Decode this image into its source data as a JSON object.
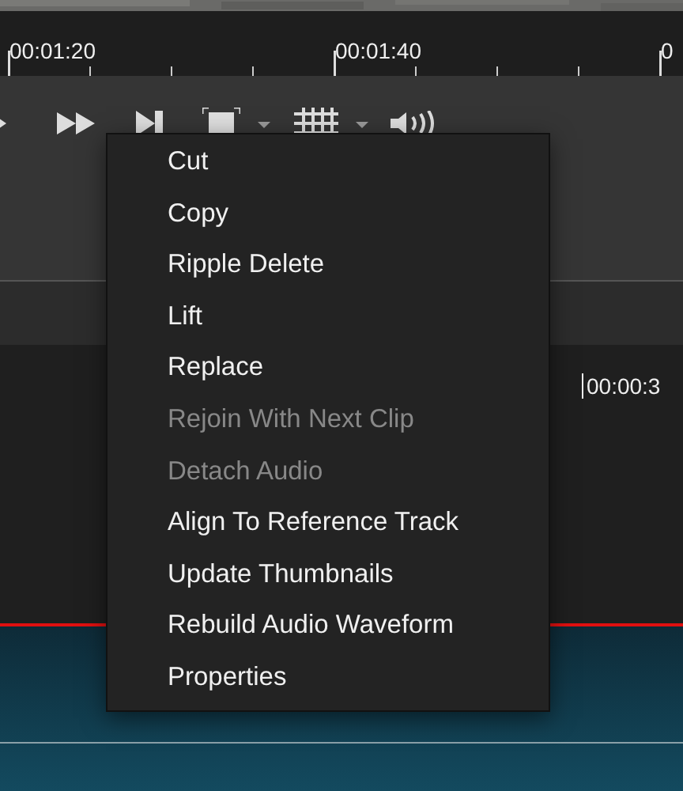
{
  "ruler": {
    "labels": [
      "00:01:20",
      "00:01:40",
      "0"
    ]
  },
  "toolbar": {
    "buttons": [
      {
        "kind": "play"
      },
      {
        "kind": "fast-forward"
      },
      {
        "kind": "skip-end"
      },
      {
        "kind": "frame",
        "dropdown": true
      },
      {
        "kind": "grid",
        "dropdown": true
      },
      {
        "kind": "volume"
      }
    ]
  },
  "timeline": {
    "timecode": "00:00:3"
  },
  "context_menu": {
    "items": [
      {
        "label": "Cut",
        "disabled": false
      },
      {
        "label": "Copy",
        "disabled": false
      },
      {
        "label": "Ripple Delete",
        "disabled": false
      },
      {
        "label": "Lift",
        "disabled": false
      },
      {
        "label": "Replace",
        "disabled": false
      },
      {
        "label": "Rejoin With Next Clip",
        "disabled": true
      },
      {
        "label": "Detach Audio",
        "disabled": true
      },
      {
        "label": "Align To Reference Track",
        "disabled": false
      },
      {
        "label": "Update Thumbnails",
        "disabled": false
      },
      {
        "label": "Rebuild Audio Waveform",
        "disabled": false
      },
      {
        "label": "Properties",
        "disabled": false
      }
    ]
  }
}
